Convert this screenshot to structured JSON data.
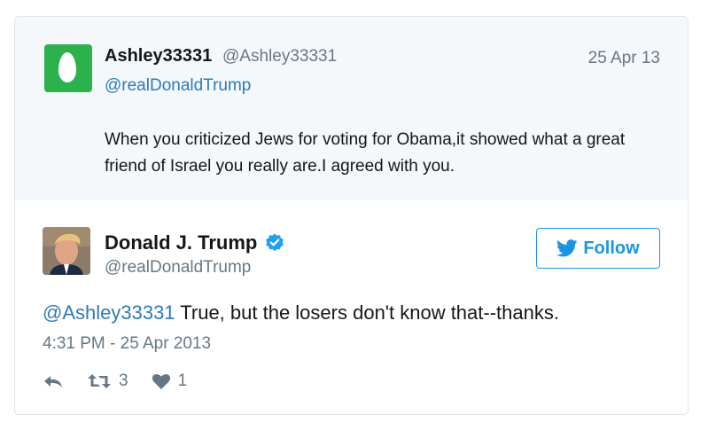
{
  "colors": {
    "link": "#2b7bb9",
    "muted": "#657786",
    "egg_green": "#2bb24c",
    "follow_blue": "#1b95e0"
  },
  "quoted_tweet": {
    "name": "Ashley33331",
    "handle": "@Ashley33331",
    "date": "25 Apr 13",
    "reply_to": "@realDonaldTrump",
    "text": "When you criticized Jews for voting for Obama,it showed what a great friend of Israel you really are.I agreed with you."
  },
  "tweet": {
    "name": "Donald J. Trump",
    "handle": "@realDonaldTrump",
    "follow_label": "Follow",
    "mention": "@Ashley33331",
    "text": " True, but the losers don't know that--thanks.",
    "timestamp": "4:31 PM - 25 Apr 2013",
    "retweets": "3",
    "likes": "1"
  }
}
